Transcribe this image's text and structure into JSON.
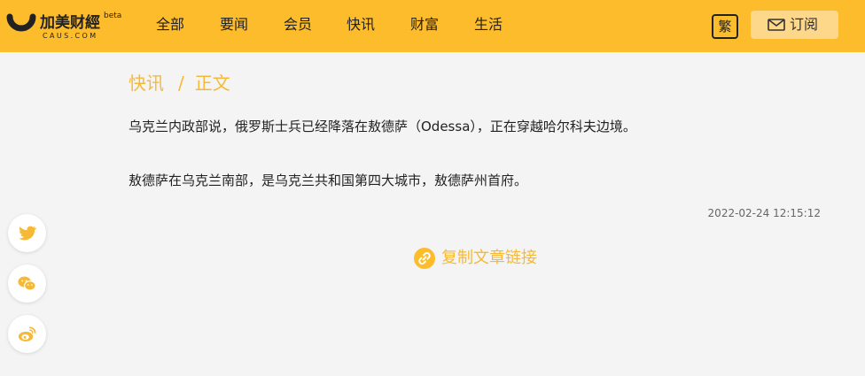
{
  "colors": {
    "brand": "#fdbc2b",
    "accent_text": "#f6b937",
    "subscribe_bg": "#fdd78a",
    "page_bg": "#f4f4f4"
  },
  "logo": {
    "name": "加美财經",
    "domain": "CAUS.COM",
    "badge": "beta"
  },
  "nav": {
    "items": [
      "全部",
      "要闻",
      "会员",
      "快讯",
      "财富",
      "生活"
    ]
  },
  "header": {
    "traditional_label": "繁",
    "subscribe_label": "订阅",
    "subscribe_icon": "envelope-icon"
  },
  "breadcrumb": {
    "section": "快讯",
    "separator": "/",
    "current": "正文"
  },
  "article": {
    "paragraphs": [
      "乌克兰内政部说，俄罗斯士兵已经降落在敖德萨（Odessa），正在穿越哈尔科夫边境。",
      "敖德萨在乌克兰南部，是乌克兰共和国第四大城市，敖德萨州首府。"
    ],
    "timestamp": "2022-02-24 12:15:12"
  },
  "actions": {
    "copy_link_label": "复制文章链接",
    "copy_link_icon": "link-icon"
  },
  "share": {
    "icons": [
      "twitter-icon",
      "wechat-icon",
      "weibo-icon"
    ]
  }
}
